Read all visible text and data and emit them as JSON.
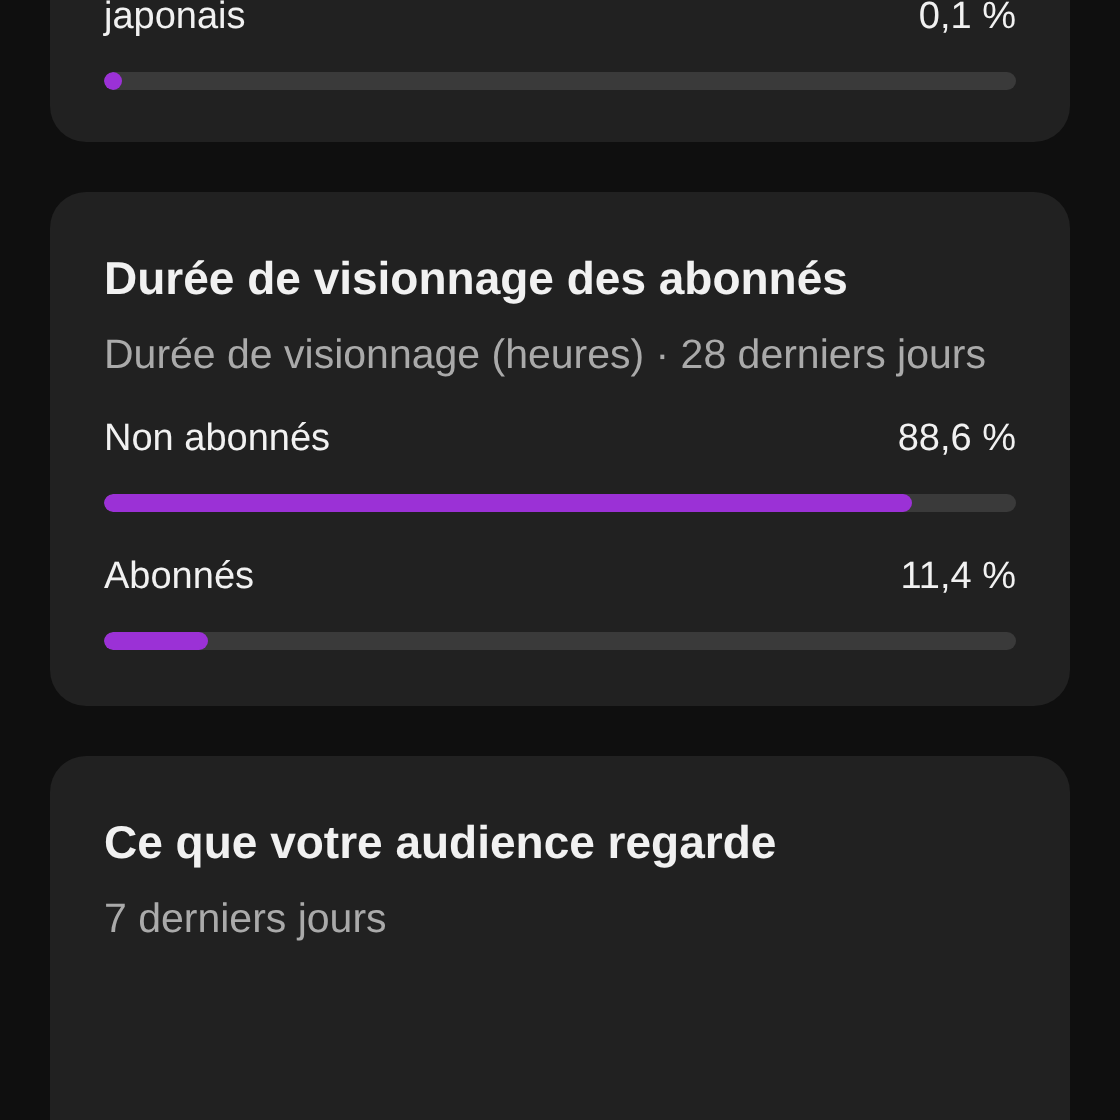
{
  "cards": [
    {
      "rows": [
        {
          "label": "japonais",
          "value": "0,1 %",
          "level": 0.001
        }
      ]
    },
    {
      "title": "Durée de visionnage des abonnés",
      "subtitle": "Durée de visionnage (heures) · 28 derniers jours",
      "rows": [
        {
          "label": "Non abonnés",
          "value": "88,6 %",
          "level": 0.886
        },
        {
          "label": "Abonnés",
          "value": "11,4 %",
          "level": 0.114
        }
      ]
    },
    {
      "title": "Ce que votre audience regarde",
      "subtitle": "7 derniers jours"
    }
  ]
}
